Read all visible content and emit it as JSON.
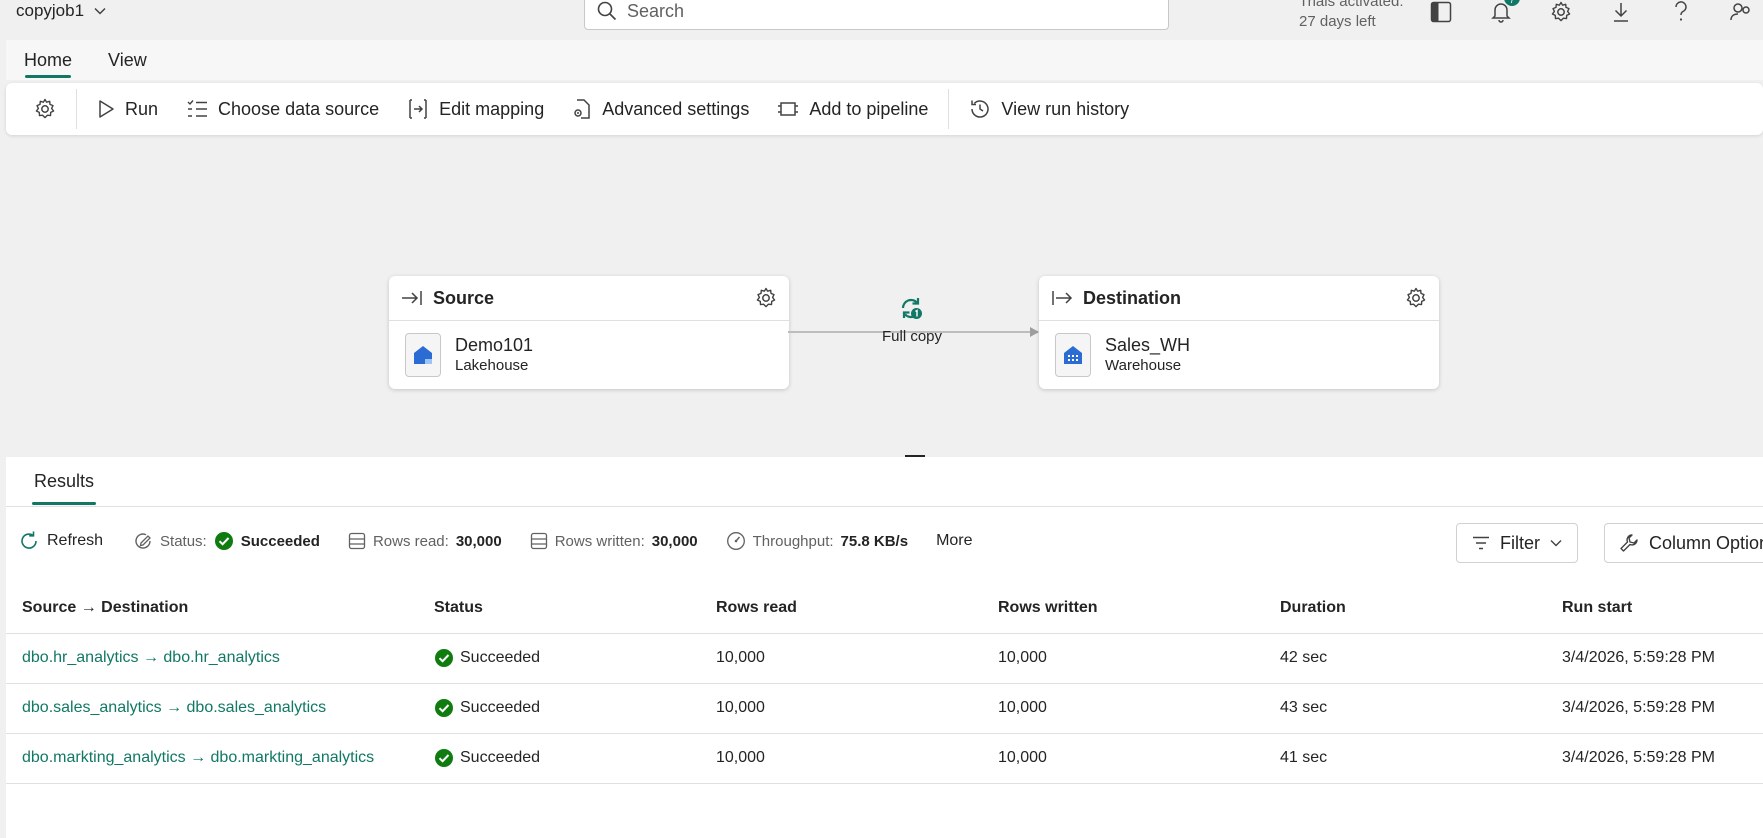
{
  "header": {
    "job_name": "copyjob1",
    "search_placeholder": "Search",
    "trial_line1": "Trials activated:",
    "trial_line2": "27 days left",
    "notification_count": "7"
  },
  "tabs": [
    {
      "label": "Home",
      "active": true
    },
    {
      "label": "View",
      "active": false
    }
  ],
  "ribbon": {
    "run": "Run",
    "choose_data_source": "Choose data source",
    "edit_mapping": "Edit mapping",
    "advanced_settings": "Advanced settings",
    "add_to_pipeline": "Add to pipeline",
    "view_run_history": "View run history"
  },
  "source": {
    "title": "Source",
    "item_name": "Demo101",
    "item_type": "Lakehouse"
  },
  "destination": {
    "title": "Destination",
    "item_name": "Sales_WH",
    "item_type": "Warehouse"
  },
  "copy_mode": "Full copy",
  "results": {
    "tab_label": "Results",
    "refresh": "Refresh",
    "status_label": "Status:",
    "status_value": "Succeeded",
    "rows_read_label": "Rows read:",
    "rows_read_value": "30,000",
    "rows_written_label": "Rows written:",
    "rows_written_value": "30,000",
    "throughput_label": "Throughput:",
    "throughput_value": "75.8 KB/s",
    "more": "More",
    "filter": "Filter",
    "column_options": "Column Options",
    "columns": [
      "Source → Destination",
      "Status",
      "Rows read",
      "Rows written",
      "Duration",
      "Run start"
    ],
    "rows": [
      {
        "mapping": "dbo.hr_analytics → dbo.hr_analytics",
        "status": "Succeeded",
        "rows_read": "10,000",
        "rows_written": "10,000",
        "duration": "42 sec",
        "run_start": "3/4/2026, 5:59:28 PM"
      },
      {
        "mapping": "dbo.sales_analytics → dbo.sales_analytics",
        "status": "Succeeded",
        "rows_read": "10,000",
        "rows_written": "10,000",
        "duration": "43 sec",
        "run_start": "3/4/2026, 5:59:28 PM"
      },
      {
        "mapping": "dbo.markting_analytics → dbo.markting_analytics",
        "status": "Succeeded",
        "rows_read": "10,000",
        "rows_written": "10,000",
        "duration": "41 sec",
        "run_start": "3/4/2026, 5:59:28 PM"
      }
    ]
  },
  "colors": {
    "accent": "#117865",
    "success": "#107c10",
    "lakehouse": "#2b6cd4"
  }
}
